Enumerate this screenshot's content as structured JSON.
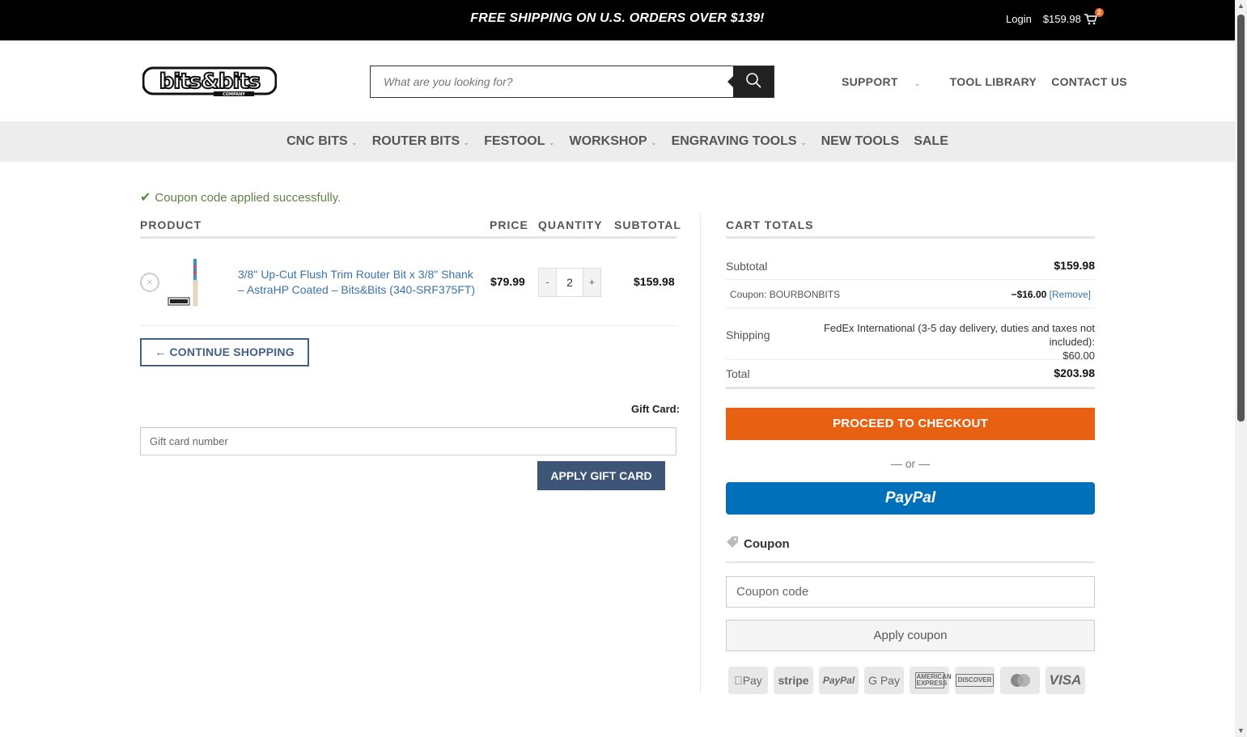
{
  "topbar": {
    "promo": "FREE SHIPPING ON U.S. ORDERS OVER $139!",
    "login": "Login",
    "cart_total": "$159.98",
    "cart_count": "2"
  },
  "header": {
    "search_placeholder": "What are you looking for?",
    "nav": [
      {
        "label": "SUPPORT",
        "dropdown": true
      },
      {
        "label": "TOOL LIBRARY"
      },
      {
        "label": "CONTACT US"
      }
    ]
  },
  "mainnav": [
    {
      "label": "CNC BITS",
      "dropdown": true
    },
    {
      "label": "ROUTER BITS",
      "dropdown": true
    },
    {
      "label": "FESTOOL",
      "dropdown": true
    },
    {
      "label": "WORKSHOP",
      "dropdown": true
    },
    {
      "label": "ENGRAVING TOOLS",
      "dropdown": true
    },
    {
      "label": "NEW TOOLS"
    },
    {
      "label": "SALE"
    }
  ],
  "notice": "Coupon code applied successfully.",
  "cart": {
    "headers": {
      "product": "PRODUCT",
      "price": "PRICE",
      "quantity": "QUANTITY",
      "subtotal": "SUBTOTAL"
    },
    "items": [
      {
        "name": "3/8\" Up-Cut Flush Trim Router Bit x 3/8\" Shank – AstraHP Coated – Bits&Bits (340-SRF375FT)",
        "price": "$79.99",
        "qty": "2",
        "subtotal": "$159.98"
      }
    ],
    "continue_label": "← CONTINUE SHOPPING",
    "qty_minus": "-",
    "qty_plus": "+"
  },
  "giftcard": {
    "label": "Gift Card:",
    "placeholder": "Gift card number",
    "button": "APPLY GIFT CARD"
  },
  "totals": {
    "heading": "CART TOTALS",
    "subtotal_label": "Subtotal",
    "subtotal": "$159.98",
    "coupon_label": "Coupon: BOURBONBITS",
    "coupon_amount": "−$16.00",
    "coupon_remove": "[Remove]",
    "shipping_label": "Shipping",
    "shipping_method": "FedEx International (3-5 day delivery, duties and taxes not included):",
    "shipping_cost": "$60.00",
    "total_label": "Total",
    "total": "$203.98",
    "checkout": "PROCEED TO CHECKOUT",
    "or": "— or —",
    "paypal": "PayPal"
  },
  "coupon": {
    "heading": "Coupon",
    "placeholder": "Coupon code",
    "button": "Apply coupon"
  },
  "payment_icons": [
    "Pay",
    "stripe",
    "PayPal",
    "G Pay",
    "AMERICAN EXPRESS",
    "DISCOVER",
    "",
    "VISA"
  ],
  "colors": {
    "accent": "#e86112",
    "link": "#3b74a8",
    "primary_button": "#3d5577",
    "paypal": "#0070ba",
    "success": "#628048"
  }
}
